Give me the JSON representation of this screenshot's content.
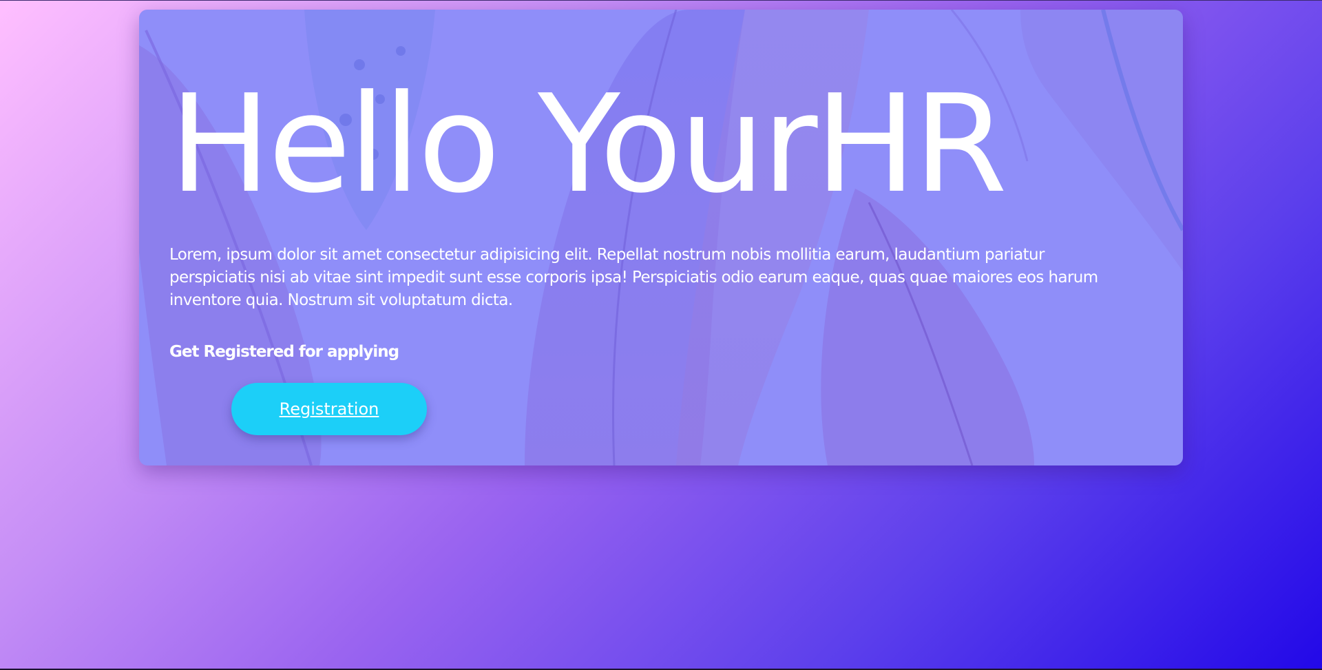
{
  "hero": {
    "title": "Hello YourHR",
    "paragraph": "Lorem, ipsum dolor sit amet consectetur adipisicing elit. Repellat nostrum nobis mollitia earum, laudantium pariatur perspiciatis nisi ab vitae sint impedit sunt esse corporis ipsa! Perspiciatis odio earum eaque, quas quae maiores eos harum inventore quia. Nostrum sit voluptatum dicta.",
    "cta_heading": "Get Registered for applying",
    "button_label": "Registration"
  },
  "colors": {
    "card_overlay": "#8f8ef9",
    "button": "#1ccff8",
    "text": "#ffffff",
    "gradient_start": "#ffbfff",
    "gradient_end": "#2208e8"
  }
}
